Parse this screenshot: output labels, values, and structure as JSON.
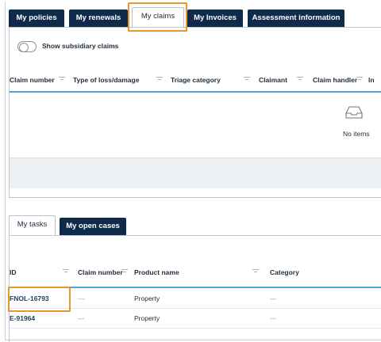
{
  "top_tabs": [
    "My policies",
    "My renewals",
    "My claims",
    "My Invoices",
    "Assessment information"
  ],
  "claims": {
    "toggle_label": "Show subsidiary claims",
    "columns": [
      "Claim number",
      "Type of loss/damage",
      "Triage category",
      "Claimant",
      "Claim handler",
      "In"
    ],
    "empty_text": "No items"
  },
  "task_tabs": [
    "My tasks",
    "My open cases"
  ],
  "tasks": {
    "columns": [
      "ID",
      "Claim number",
      "Product name",
      "Category"
    ],
    "rows": [
      {
        "id": "FNOL-16793",
        "claim_number": "---",
        "product": "Property",
        "category": "---"
      },
      {
        "id": "E-91964",
        "claim_number": "---",
        "product": "Property",
        "category": "---"
      }
    ]
  },
  "colors": {
    "tab_dark": "#0f2b4c",
    "highlight": "#e8962e",
    "header_line": "#45a5d8"
  }
}
